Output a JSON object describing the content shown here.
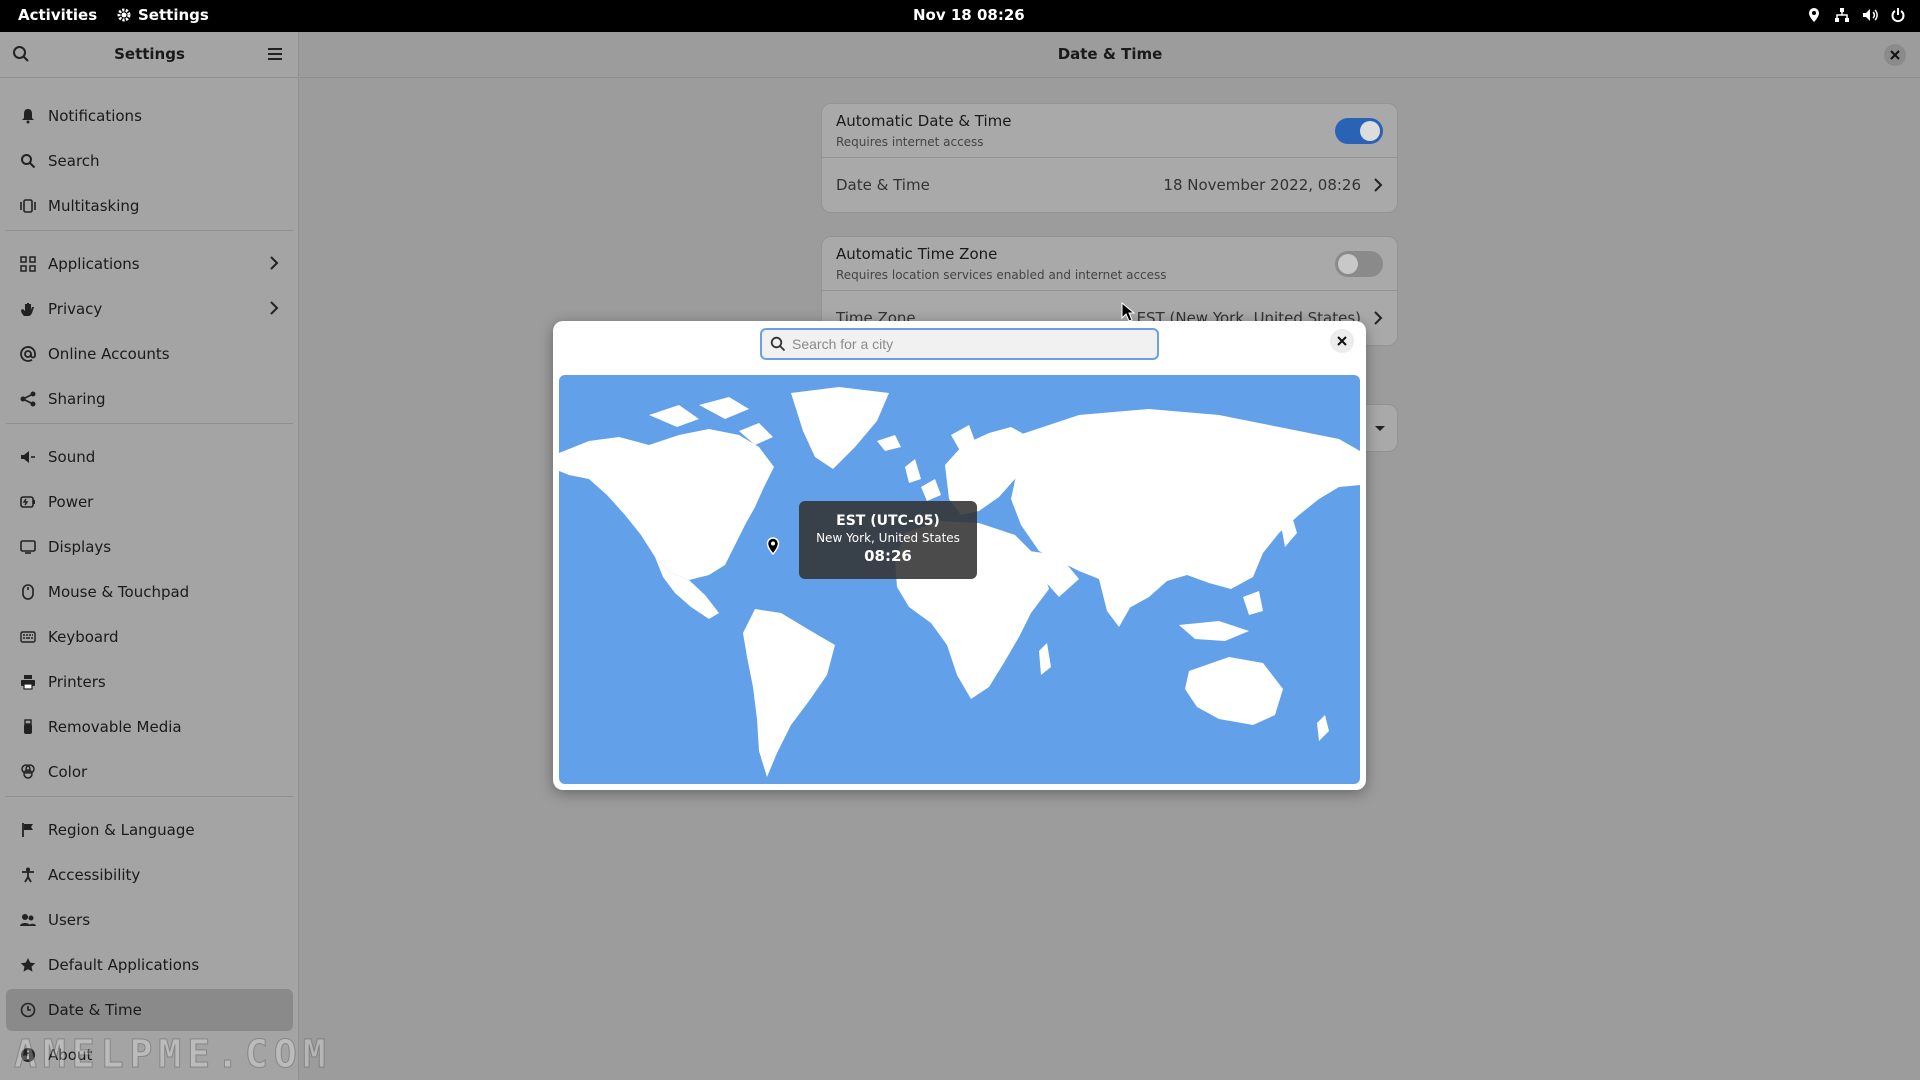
{
  "topbar": {
    "activities": "Activities",
    "app_name": "Settings",
    "clock": "Nov 18  08:26",
    "tray_icons": [
      "location-icon",
      "network-icon",
      "volume-icon",
      "power-icon"
    ]
  },
  "sidebar": {
    "title": "Settings",
    "items": [
      {
        "label": "Notifications",
        "icon": "bell-icon"
      },
      {
        "label": "Search",
        "icon": "search-icon"
      },
      {
        "label": "Multitasking",
        "icon": "multitasking-icon"
      },
      {
        "label": "Applications",
        "icon": "grid-icon",
        "chevron": true
      },
      {
        "label": "Privacy",
        "icon": "hand-icon",
        "chevron": true
      },
      {
        "label": "Online Accounts",
        "icon": "at-icon"
      },
      {
        "label": "Sharing",
        "icon": "share-icon"
      },
      {
        "label": "Sound",
        "icon": "speaker-icon"
      },
      {
        "label": "Power",
        "icon": "battery-icon"
      },
      {
        "label": "Displays",
        "icon": "display-icon"
      },
      {
        "label": "Mouse & Touchpad",
        "icon": "mouse-icon"
      },
      {
        "label": "Keyboard",
        "icon": "keyboard-icon"
      },
      {
        "label": "Printers",
        "icon": "printer-icon"
      },
      {
        "label": "Removable Media",
        "icon": "usb-icon"
      },
      {
        "label": "Color",
        "icon": "color-icon"
      },
      {
        "label": "Region & Language",
        "icon": "flag-icon"
      },
      {
        "label": "Accessibility",
        "icon": "accessibility-icon"
      },
      {
        "label": "Users",
        "icon": "users-icon"
      },
      {
        "label": "Default Applications",
        "icon": "star-icon"
      },
      {
        "label": "Date & Time",
        "icon": "clock-icon",
        "selected": true
      },
      {
        "label": "About",
        "icon": "info-icon"
      }
    ]
  },
  "main": {
    "title": "Date & Time",
    "auto_datetime": {
      "label": "Automatic Date & Time",
      "sub": "Requires internet access",
      "enabled": true
    },
    "datetime": {
      "label": "Date & Time",
      "value": "18 November 2022, 08:26"
    },
    "auto_timezone": {
      "label": "Automatic Time Zone",
      "sub": "Requires location services enabled and internet access",
      "enabled": false
    },
    "timezone": {
      "label": "Time Zone",
      "value": "EST (New York, United States)"
    }
  },
  "dialog": {
    "search_placeholder": "Search for a city",
    "tooltip": {
      "zone": "EST (UTC-05)",
      "city": "New York, United States",
      "time": "08:26"
    }
  },
  "colors": {
    "accent": "#2a63b5",
    "map_ocean": "#62a0ea",
    "map_land": "#ffffff"
  },
  "watermark": "AMELPME.COM"
}
